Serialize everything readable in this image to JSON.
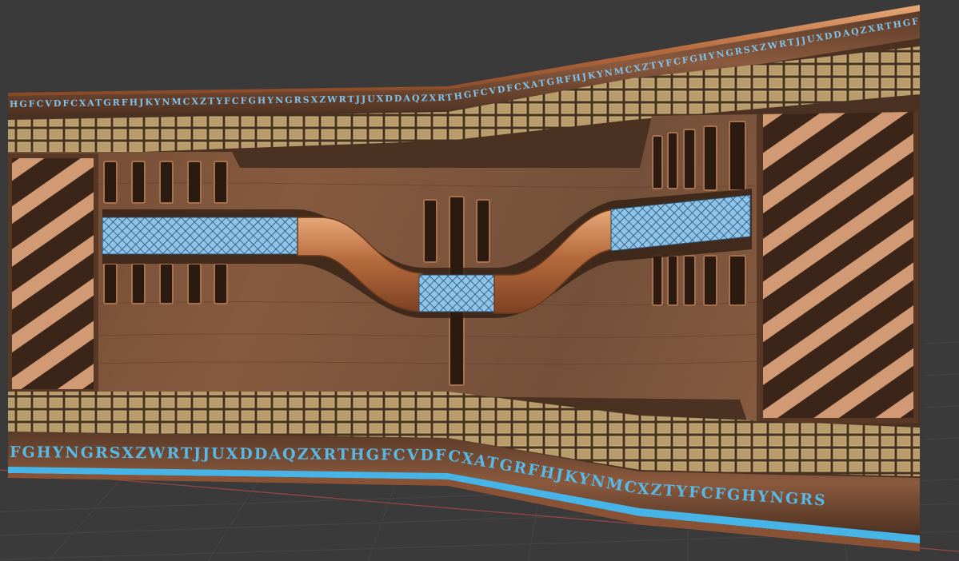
{
  "scene": {
    "colors": {
      "viewport_bg": "#3a3a3a",
      "grid_line": "#474747",
      "axis_x": "#9a4646",
      "wood_dark": "#5a3a26",
      "wood_mid": "#7b5238",
      "wood_light": "#a57455",
      "copper": "#b86b3f",
      "copper_light": "#e0a070",
      "tile": "#b59a6a",
      "tile_edge": "#4a3220",
      "accent_blue": "#46b4e6",
      "mesh_blue": "#7fb6de",
      "stripe_light": "#d9a07a"
    },
    "top_lettering": "HGFCVDFCXATGRFHJKYNMCXZTYFCFGHYNGRSXZWRTJJUXDDAQZXRTHGFCVDFCXATGRFHJKYNMCXZTYFCFGHYNGRSXZWRTJJUXDDAQZXRTHGFCVDFCXA",
    "bottom_lettering": "FGHYNGRSXZWRTJJUXDDAQZXRTHGFCVDFCXATGRFHJKYNMCXZTYFCFGHYNGRS"
  }
}
